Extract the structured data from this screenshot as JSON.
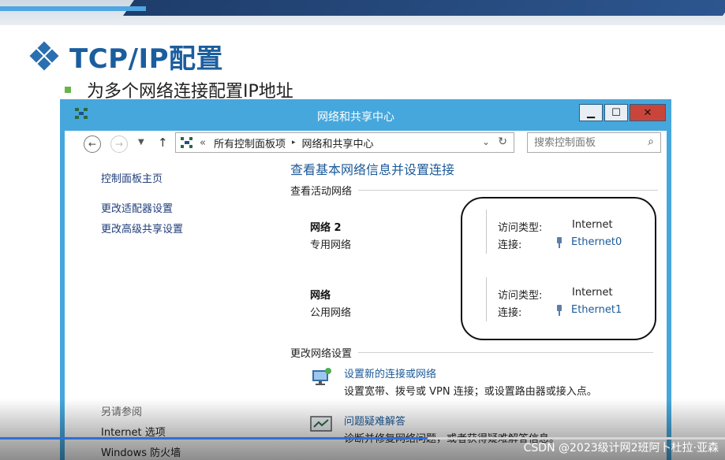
{
  "slide": {
    "title": "TCP/IP配置",
    "bullet": "为多个网络连接配置IP地址"
  },
  "window": {
    "title": "网络和共享中心",
    "buttons": {
      "minimize": "▁",
      "maximize": "☐",
      "close": "✕"
    }
  },
  "addressbar": {
    "chevron": "«",
    "crumbs": [
      "所有控制面板项",
      "网络和共享中心"
    ],
    "separator": "▸",
    "search_placeholder": "搜索控制面板"
  },
  "sidebar": {
    "home": "控制面板主页",
    "links": [
      "更改适配器设置",
      "更改高级共享设置"
    ],
    "see_also_label": "另请参阅",
    "see_also": [
      "Internet 选项",
      "Windows 防火墙"
    ]
  },
  "main": {
    "heading": "查看基本网络信息并设置连接",
    "active_label": "查看活动网络",
    "networks": [
      {
        "name": "网络  2",
        "category": "专用网络",
        "access_label": "访问类型:",
        "access_value": "Internet",
        "conn_label": "连接:",
        "conn_value": "Ethernet0"
      },
      {
        "name": "网络",
        "category": "公用网络",
        "access_label": "访问类型:",
        "access_value": "Internet",
        "conn_label": "连接:",
        "conn_value": "Ethernet1"
      }
    ],
    "change_label": "更改网络设置",
    "actions": [
      {
        "link": "设置新的连接或网络",
        "desc": "设置宽带、拨号或 VPN 连接；或设置路由器或接入点。"
      },
      {
        "link": "问题疑难解答",
        "desc": "诊断并修复网络问题，或者获得疑难解答信息。"
      }
    ]
  },
  "video": {
    "progress": 0.59,
    "watermark": "CSDN @2023级计网2班阿卜杜拉·亚森"
  },
  "colors": {
    "title_blue": "#1b5e9e",
    "frame_blue": "#46a7dc",
    "link_blue": "#1c5a99",
    "bullet_green": "#69b449"
  }
}
